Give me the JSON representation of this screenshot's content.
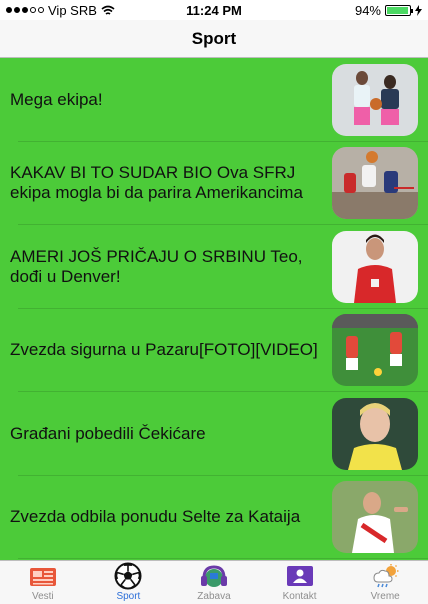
{
  "status": {
    "carrier": "Vip SRB",
    "time": "11:24 PM",
    "battery": "94%",
    "battery_level": 0.94
  },
  "nav": {
    "title": "Sport"
  },
  "articles": [
    {
      "title": "Mega ekipa!",
      "thumb": "basketball-duo-photo"
    },
    {
      "title": "KAKAV BI TO SUDAR BIO Ova SFRJ ekipa mogla bi da parira Amerikancima",
      "thumb": "basketball-dunk-photo"
    },
    {
      "title": "AMERI JOŠ PRIČAJU O SRBINU Teo, dođi u Denver!",
      "thumb": "basketball-player-portrait"
    },
    {
      "title": "Zvezda sigurna u Pazaru[FOTO][VIDEO]",
      "thumb": "football-match-photo"
    },
    {
      "title": "Građani pobedili Čekićare",
      "thumb": "footballer-portrait"
    },
    {
      "title": "Zvezda odbila ponudu Selte za Kataija",
      "thumb": "footballer-celebration"
    }
  ],
  "tabs": [
    {
      "label": "Vesti",
      "icon": "newspaper-icon",
      "active": false
    },
    {
      "label": "Sport",
      "icon": "soccer-ball-icon",
      "active": true
    },
    {
      "label": "Zabava",
      "icon": "headphones-icon",
      "active": false
    },
    {
      "label": "Kontakt",
      "icon": "contact-card-icon",
      "active": false
    },
    {
      "label": "Vreme",
      "icon": "weather-icon",
      "active": false
    }
  ],
  "colors": {
    "list_background": "#4ccb39",
    "tab_active": "#2d6fd8",
    "tab_inactive": "#8e8e8e"
  }
}
